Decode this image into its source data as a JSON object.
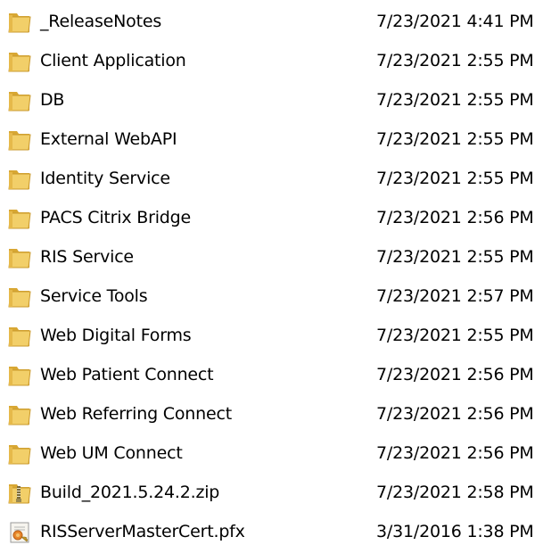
{
  "files": [
    {
      "name": "_ReleaseNotes",
      "modified": "7/23/2021 4:41 PM",
      "icon": "folder-icon"
    },
    {
      "name": "Client Application",
      "modified": "7/23/2021 2:55 PM",
      "icon": "folder-icon"
    },
    {
      "name": "DB",
      "modified": "7/23/2021 2:55 PM",
      "icon": "folder-icon"
    },
    {
      "name": "External WebAPI",
      "modified": "7/23/2021 2:55 PM",
      "icon": "folder-icon"
    },
    {
      "name": "Identity Service",
      "modified": "7/23/2021 2:55 PM",
      "icon": "folder-icon"
    },
    {
      "name": "PACS Citrix Bridge",
      "modified": "7/23/2021 2:56 PM",
      "icon": "folder-icon"
    },
    {
      "name": "RIS Service",
      "modified": "7/23/2021 2:55 PM",
      "icon": "folder-icon"
    },
    {
      "name": "Service Tools",
      "modified": "7/23/2021 2:57 PM",
      "icon": "folder-icon"
    },
    {
      "name": "Web Digital Forms",
      "modified": "7/23/2021 2:55 PM",
      "icon": "folder-icon"
    },
    {
      "name": "Web Patient Connect",
      "modified": "7/23/2021 2:56 PM",
      "icon": "folder-icon"
    },
    {
      "name": "Web Referring Connect",
      "modified": "7/23/2021 2:56 PM",
      "icon": "folder-icon"
    },
    {
      "name": "Web UM Connect",
      "modified": "7/23/2021 2:56 PM",
      "icon": "folder-icon"
    },
    {
      "name": "Build_2021.5.24.2.zip",
      "modified": "7/23/2021 2:58 PM",
      "icon": "zip-folder-icon"
    },
    {
      "name": "RISServerMasterCert.pfx",
      "modified": "3/31/2016 1:38 PM",
      "icon": "certificate-icon"
    }
  ],
  "colors": {
    "folder_front": "#f2cf69",
    "folder_back": "#d8a733",
    "zip_zipper": "#7a6a3a",
    "cert_seal": "#e8862b"
  }
}
